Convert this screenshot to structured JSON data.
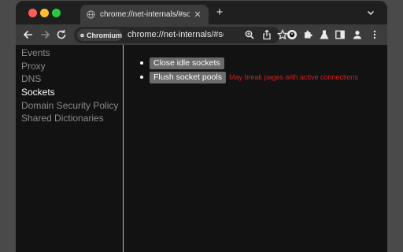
{
  "browser": {
    "tab": {
      "title": "chrome://net-internals/#sockets",
      "favicon": "globe-icon",
      "close_glyph": "✕"
    },
    "new_tab_glyph": "+",
    "omnibox": {
      "chip_label": "Chromium",
      "url": "chrome://net-internals/#sockets"
    },
    "toolbar_icons": [
      "back-icon",
      "forward-icon",
      "reload-icon",
      "zoom-icon",
      "share-icon",
      "bookmark-star-icon",
      "extension-icon",
      "puzzle-icon",
      "flask-icon",
      "side-panel-icon",
      "profile-icon",
      "menu-icon"
    ]
  },
  "sidebar": {
    "items": [
      {
        "label": "Events"
      },
      {
        "label": "Proxy"
      },
      {
        "label": "DNS"
      },
      {
        "label": "Sockets",
        "active": true
      },
      {
        "label": "Domain Security Policy"
      },
      {
        "label": "Shared Dictionaries"
      }
    ]
  },
  "main": {
    "close_idle_label": "Close idle sockets",
    "flush_label": "Flush socket pools",
    "flush_warning": "May break pages with active connections"
  },
  "colors": {
    "warning": "#d31f1f",
    "active_nav": "#ffffff",
    "inactive_nav": "#8a8a8a",
    "button_bg": "#6b6b6b"
  }
}
